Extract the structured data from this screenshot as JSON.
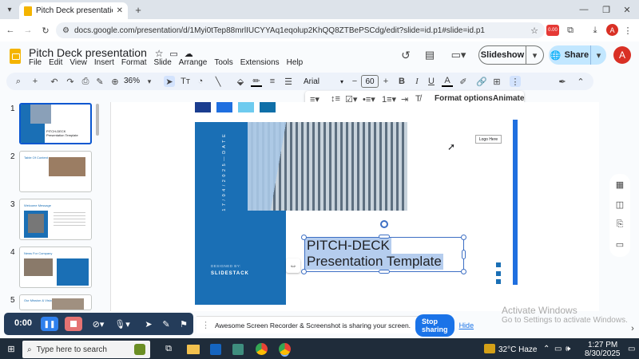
{
  "browser": {
    "tab_title": "Pitch Deck presentation - Goog",
    "url": "docs.google.com/presentation/d/1Myi0tTep88mrlIUCYYAq1eqolup2KhQQ8ZTBePSCdg/edit?slide=id.p1#slide=id.p1",
    "ext_badge": "0.00",
    "profile_initial": "A"
  },
  "app": {
    "doc_title": "Pitch Deck presentation",
    "menus": [
      "File",
      "Edit",
      "View",
      "Insert",
      "Format",
      "Slide",
      "Arrange",
      "Tools",
      "Extensions",
      "Help"
    ],
    "slideshow_label": "Slideshow",
    "share_label": "Share",
    "user_initial": "A"
  },
  "toolbar": {
    "zoom": "36%",
    "font": "Arial",
    "font_size": "60",
    "format_options": "Format options",
    "animate": "Animate"
  },
  "filmstrip": {
    "numbers": [
      "1",
      "2",
      "3",
      "4",
      "5"
    ],
    "thumbs": [
      {
        "title": "PITCH-DECK",
        "subtitle": "Presentation Template"
      },
      {
        "title": "Table Of Content"
      },
      {
        "title": "Welcome Message"
      },
      {
        "title": "News For Company"
      },
      {
        "title": "Our Mission & Vision"
      }
    ]
  },
  "slide": {
    "date_text": "1 7 / 0 4 / 2 0 2 5  —  D A T E",
    "designed_by": "DESIGNED BY:",
    "brand": "SLIDESTACK",
    "logo": "Logo Here",
    "title_line1": "PITCH-DECK",
    "title_line2": "Presentation Template",
    "social_icons": [
      "f",
      "t",
      "in"
    ],
    "accent_color": "#1a6fb5",
    "palette": [
      "#1a3d8f",
      "#1f6fe0",
      "#6ecbef",
      "#0f6fa8"
    ]
  },
  "recorder": {
    "time": "0:00",
    "share_message": "Awesome Screen Recorder & Screenshot is sharing your screen.",
    "stop_label": "Stop sharing",
    "hide_label": "Hide"
  },
  "watermark": {
    "line1": "Activate Windows",
    "line2": "Go to Settings to activate Windows."
  },
  "taskbar": {
    "search_placeholder": "Type here to search",
    "weather": "32°C  Haze",
    "time": "1:27 PM",
    "date": "8/30/2025"
  }
}
